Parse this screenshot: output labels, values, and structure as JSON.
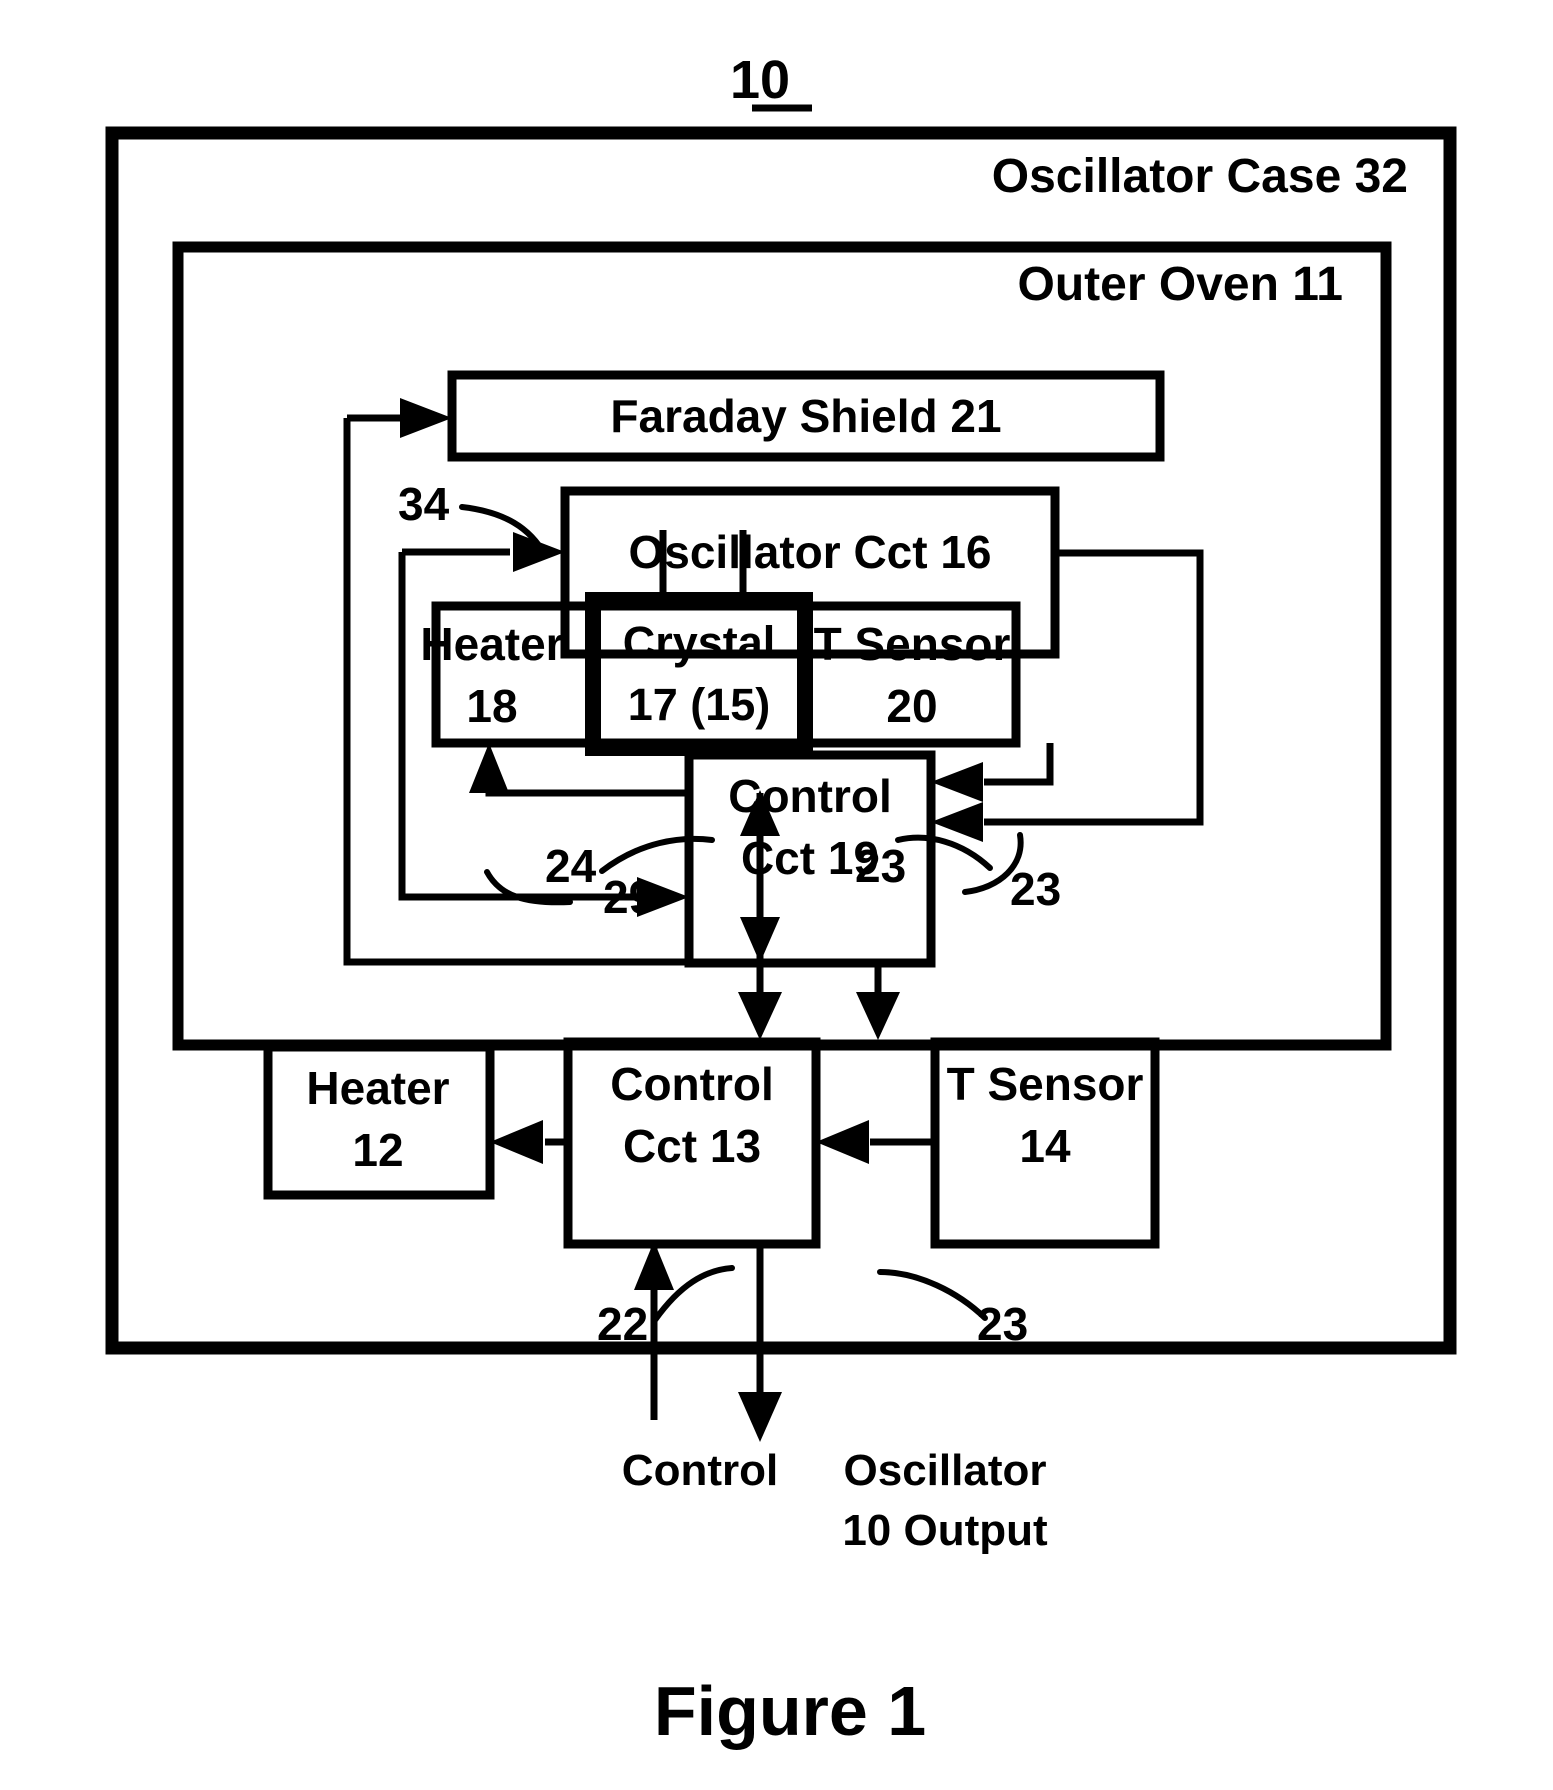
{
  "figure": {
    "number_label": "10",
    "caption": "Figure 1"
  },
  "enclosures": {
    "oscillator_case": {
      "label": "Oscillator Case 32",
      "name": "Oscillator Case",
      "ref": "32"
    },
    "outer_oven": {
      "label": "Outer Oven 11",
      "name": "Outer Oven",
      "ref": "11"
    }
  },
  "blocks": {
    "faraday_shield": {
      "label": "Faraday Shield 21",
      "name": "Faraday Shield",
      "ref": "21"
    },
    "oscillator_cct": {
      "label": "Oscillator Cct 16",
      "name": "Oscillator Cct",
      "ref": "16"
    },
    "inner_heater": {
      "line1": "Heater",
      "line2": "18",
      "name": "Heater",
      "ref": "18"
    },
    "crystal": {
      "line1": "Crystal",
      "line2": "17 (15)",
      "name": "Crystal",
      "ref": "17 (15)"
    },
    "inner_t_sensor": {
      "line1": "T Sensor",
      "line2": "20",
      "name": "T Sensor",
      "ref": "20"
    },
    "inner_control_cct": {
      "line1": "Control",
      "line2": "Cct 19",
      "name": "Control Cct",
      "ref": "19"
    },
    "outer_heater": {
      "line1": "Heater",
      "line2": "12",
      "name": "Heater",
      "ref": "12"
    },
    "outer_control_cct": {
      "line1": "Control",
      "line2": "Cct 13",
      "name": "Control Cct",
      "ref": "13"
    },
    "outer_t_sensor": {
      "line1": "T Sensor",
      "line2": "14",
      "name": "T Sensor",
      "ref": "14"
    }
  },
  "reference_numerals": {
    "n34": "34",
    "n29": "29",
    "n23_inner": "23",
    "n24": "24",
    "n23_mid": "23",
    "n22": "22",
    "n23_bottom": "23"
  },
  "io_labels": {
    "control_input": "Control",
    "oscillator_output_line1": "Oscillator",
    "oscillator_output_line2": "10 Output"
  },
  "colors": {
    "ink": "#000000",
    "paper": "#ffffff"
  }
}
